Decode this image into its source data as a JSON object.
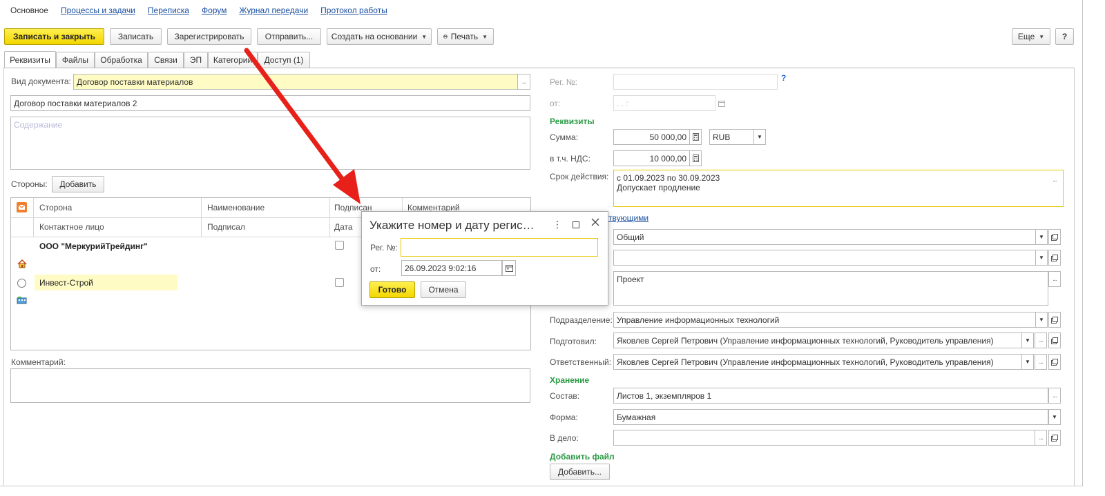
{
  "topnav": {
    "items": [
      "Основное",
      "Процессы и задачи",
      "Переписка",
      "Форум",
      "Журнал передачи",
      "Протокол работы"
    ]
  },
  "toolbar": {
    "save_close": "Записать и закрыть",
    "save": "Записать",
    "register": "Зарегистрировать",
    "send": "Отправить...",
    "create_based": "Создать на основании",
    "print": "Печать",
    "more": "Еще",
    "help": "?"
  },
  "tabs": [
    "Реквизиты",
    "Файлы",
    "Обработка",
    "Связи",
    "ЭП",
    "Категории",
    "Доступ (1)"
  ],
  "left": {
    "doc_type_label": "Вид документа:",
    "doc_type_value": "Договор поставки материалов",
    "title_value": "Договор поставки материалов 2",
    "content_placeholder": "Содержание",
    "parties_label": "Стороны:",
    "add_button": "Добавить",
    "grid_headers": {
      "side": "Сторона",
      "name": "Наименование",
      "signed": "Подписан",
      "comment": "Комментарий",
      "contact": "Контактное лицо",
      "signer": "Подписал",
      "date": "Дата"
    },
    "parties": [
      "ООО \"МеркурийТрейдинг\"",
      "Инвест-Строй"
    ],
    "comment_label": "Комментарий:"
  },
  "right": {
    "reg_no_label": "Рег. №:",
    "reg_no_help": "?",
    "from_label": "от:",
    "from_placeholder": ". .   :",
    "requisites_section": "Реквизиты",
    "sum_label": "Сумма:",
    "sum_value": "50 000,00",
    "currency": "RUB",
    "vat_label": "в т.ч. НДС:",
    "vat_value": "10 000,00",
    "validity_label": "Срок действия:",
    "validity_line1": "с 01.09.2023 по 30.09.2023",
    "validity_line2": "Допускает продление",
    "participants_link": "твующими",
    "access_value": "Общий",
    "state_value": "Проект",
    "department_label": "Подразделение:",
    "department_value": "Управление информационных технологий",
    "prepared_label": "Подготовил:",
    "prepared_value": "Яковлев Сергей Петрович (Управление информационных технологий, Руководитель управления)",
    "responsible_label": "Ответственный:",
    "responsible_value": "Яковлев Сергей Петрович (Управление информационных технологий, Руководитель управления)",
    "storage_section": "Хранение",
    "composition_label": "Состав:",
    "composition_value": "Листов 1, экземпляров 1",
    "form_label": "Форма:",
    "form_value": "Бумажная",
    "case_label": "В дело:",
    "add_file_section": "Добавить файл",
    "add_file_button": "Добавить..."
  },
  "dialog": {
    "title": "Укажите номер и дату регис…",
    "reg_no_label": "Рег. №:",
    "from_label": "от:",
    "date_value": "26.09.2023  9:02:16",
    "ok": "Готово",
    "cancel": "Отмена"
  },
  "colors": {
    "accent_yellow": "#f3d600",
    "field_yellow": "#fffbc4",
    "section_green": "#2a9a44",
    "link_blue": "#1a4fa0",
    "arrow_red": "#e8201a"
  }
}
